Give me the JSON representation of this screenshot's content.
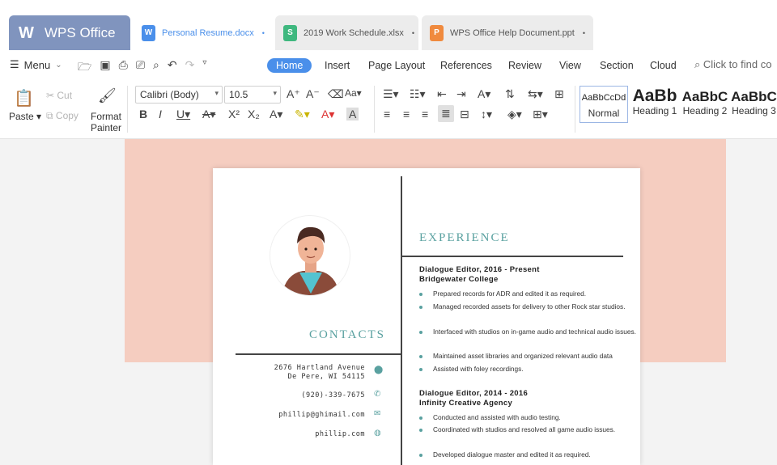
{
  "app": {
    "name": "WPS Office"
  },
  "tabs": [
    {
      "label": "Personal Resume.docx",
      "color": "#4a8fea",
      "glyph": "W"
    },
    {
      "label": "2019 Work Schedule.xlsx",
      "color": "#3fb87f",
      "glyph": "S"
    },
    {
      "label": "WPS Office Help Document.ppt",
      "color": "#f08a3e",
      "glyph": "P"
    }
  ],
  "menu": {
    "label": "Menu",
    "ribbon_tabs": [
      "Home",
      "Insert",
      "Page Layout",
      "References",
      "Review",
      "View",
      "Section",
      "Cloud"
    ],
    "find_placeholder": "Click to find co"
  },
  "toolbar": {
    "paste": "Paste",
    "cut": "Cut",
    "copy": "Copy",
    "format_painter_line1": "Format",
    "format_painter_line2": "Painter",
    "font_name": "Calibri (Body)",
    "font_size": "10.5",
    "styles": [
      {
        "sample": "AaBbCcDd",
        "label": "Normal"
      },
      {
        "sample": "AaBb",
        "label": "Heading 1"
      },
      {
        "sample": "AaBbC",
        "label": "Heading 2"
      },
      {
        "sample": "AaBbC",
        "label": "Heading 3"
      }
    ]
  },
  "resume": {
    "experience_title": "EXPERIENCE",
    "contacts_title": "CONTACTS",
    "address_line1": "2676 Hartland Avenue",
    "address_line2": "De Pere, WI 54115",
    "phone": "(920)-339-7675",
    "email": "phillip@ghimail.com",
    "website": "phillip.com",
    "jobs": [
      {
        "title": "Dialogue Editor, 2016 - Present",
        "org": "Bridgewater College",
        "bullets": [
          "Prepared records for ADR and edited it as required.",
          "Managed recorded assets for delivery to other Rock star studios.",
          "Interfaced with studios on in-game audio and technical audio issues.",
          "Maintained asset libraries and organized relevant audio data",
          "Assisted with foley recordings."
        ]
      },
      {
        "title": "Dialogue Editor, 2014 - 2016",
        "org": "Infinity Creative Agency",
        "bullets": [
          "Conducted and assisted with audio testing.",
          "Coordinated with studios and resolved all game audio issues.",
          "Developed dialogue master and edited it as required."
        ]
      }
    ]
  }
}
